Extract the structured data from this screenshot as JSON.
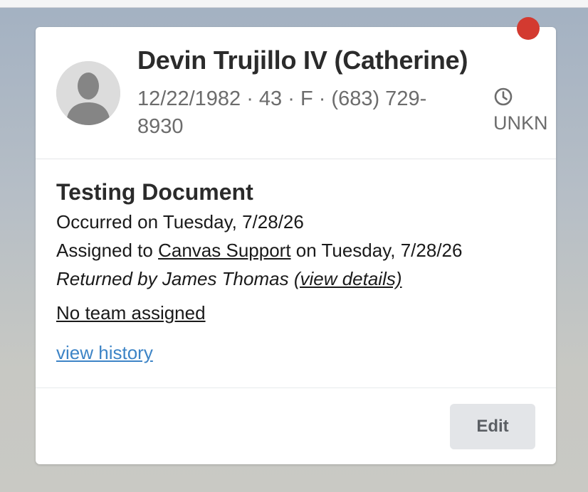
{
  "patient": {
    "name": "Devin Trujillo IV (Catherine)",
    "info": "12/22/1982 · 43 · F · (683) 729-8930",
    "status_label": "UNKN"
  },
  "document": {
    "title": "Testing Document",
    "occurred_text": "Occurred on Tuesday, 7/28/26",
    "assigned_prefix": "Assigned to ",
    "assigned_to": "Canvas Support",
    "assigned_suffix": " on Tuesday, 7/28/26",
    "returned_prefix": "Returned by James Thomas ",
    "view_details": "(view details)",
    "team_link": "No team assigned",
    "history_link": "view history"
  },
  "footer": {
    "edit_label": "Edit"
  },
  "icons": {
    "avatar": "person-silhouette-icon",
    "clock": "clock-icon",
    "notification": "notification-dot-icon"
  },
  "colors": {
    "notification_dot": "#d33a30",
    "link_blue": "#3d84c6",
    "button_bg": "#e3e5e8"
  }
}
